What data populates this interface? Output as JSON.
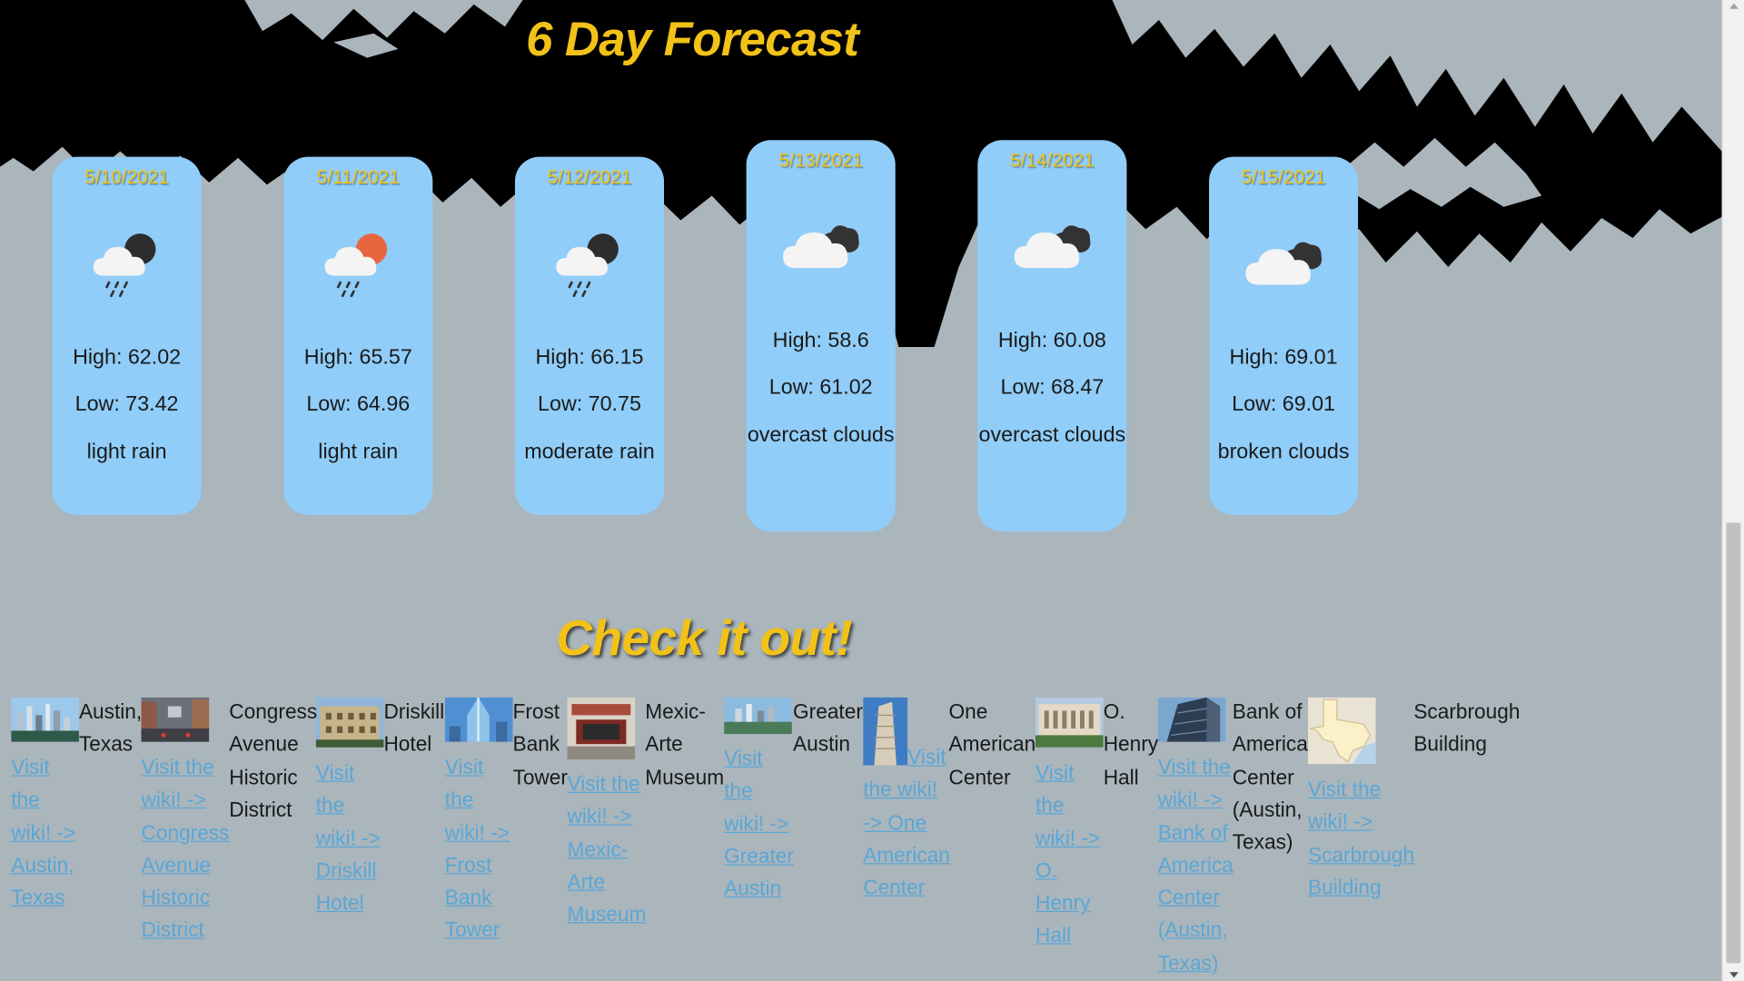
{
  "header": {
    "title": "6 Day Forecast"
  },
  "forecast": [
    {
      "date": "5/10/2021",
      "icon": "rain-night-icon",
      "high": "High: 62.02",
      "low": "Low: 73.42",
      "desc": "light rain"
    },
    {
      "date": "5/11/2021",
      "icon": "rain-day-icon",
      "high": "High: 65.57",
      "low": "Low: 64.96",
      "desc": "light rain"
    },
    {
      "date": "5/12/2021",
      "icon": "rain-night-icon",
      "high": "High: 66.15",
      "low": "Low: 70.75",
      "desc": "moderate rain"
    },
    {
      "date": "5/13/2021",
      "icon": "cloudy-icon",
      "high": "High: 58.6",
      "low": "Low: 61.02",
      "desc": "overcast clouds"
    },
    {
      "date": "5/14/2021",
      "icon": "cloudy-icon",
      "high": "High: 60.08",
      "low": "Low: 68.47",
      "desc": "overcast clouds"
    },
    {
      "date": "5/15/2021",
      "icon": "cloudy-icon",
      "high": "High: 69.01",
      "low": "Low: 69.01",
      "desc": "broken clouds"
    }
  ],
  "check": {
    "title": "Check it out!",
    "places": [
      {
        "name": "Austin, Texas",
        "link": "Visit the wiki! -> Austin, Texas"
      },
      {
        "name": "Congress Avenue Historic District",
        "link": "Visit the wiki! -> Congress Avenue Historic District"
      },
      {
        "name": "Driskill Hotel",
        "link": "Visit the wiki! -> Driskill Hotel"
      },
      {
        "name": "Frost Bank Tower",
        "link": "Visit the wiki! -> Frost Bank Tower"
      },
      {
        "name": "Mexic-Arte Museum",
        "link": "Visit the wiki! -> Mexic-Arte Museum"
      },
      {
        "name": "Greater Austin",
        "link": "Visit the wiki! -> Greater Austin"
      },
      {
        "name": "One American Center",
        "link": "Visit the wiki! -> One American Center"
      },
      {
        "name": "O. Henry Hall",
        "link": "Visit the wiki! -> O. Henry Hall"
      },
      {
        "name": "Bank of America Center (Austin, Texas)",
        "link": "Visit the wiki! -> Bank of America Center (Austin, Texas)"
      },
      {
        "name": "Scarbrough Building",
        "link": "Visit the wiki! -> Scarbrough Building"
      }
    ]
  },
  "colors": {
    "heading": "#f2c218",
    "card": "#90cdf8",
    "link": "#5aa7d6",
    "background": "#aab5bc"
  }
}
